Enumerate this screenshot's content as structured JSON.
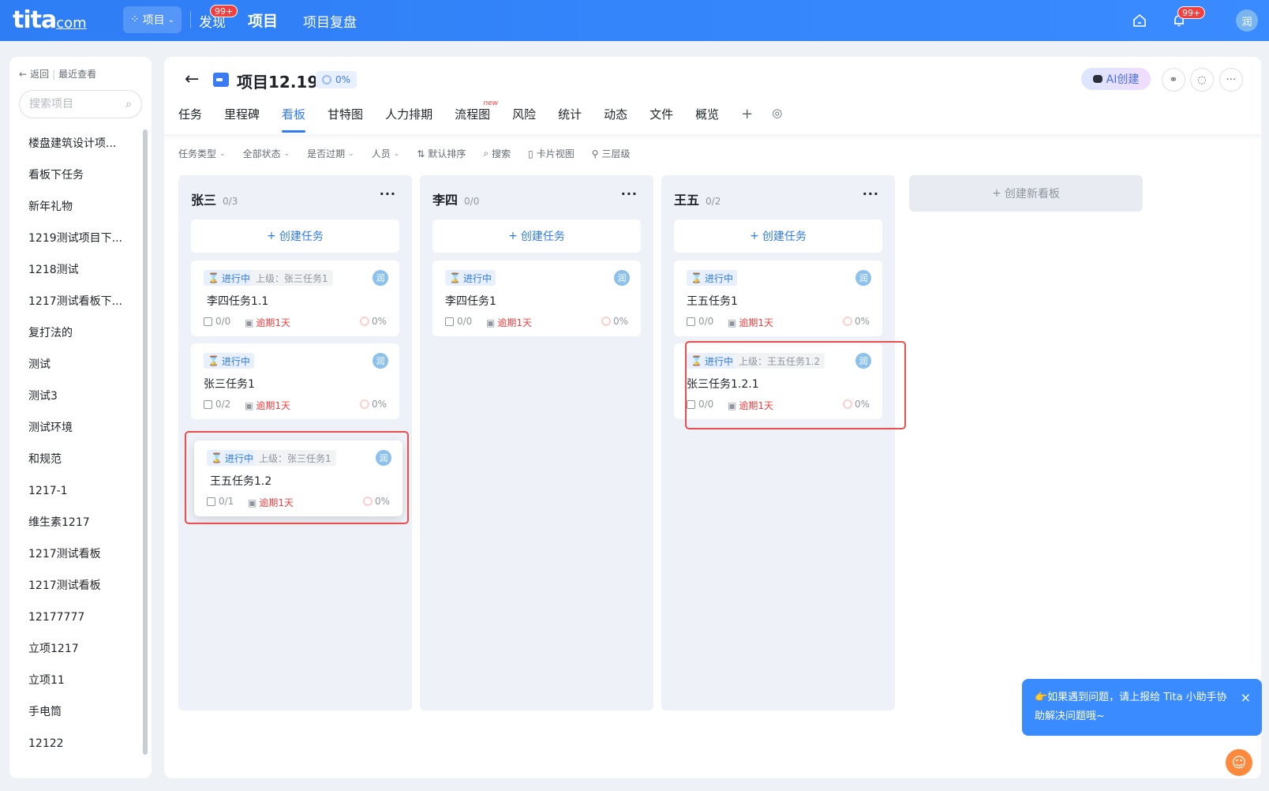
{
  "topbar": {
    "logo": "tita",
    "logo_suffix": "com",
    "project_switch": "项目",
    "nav": [
      {
        "label": "发现",
        "badge": "99+"
      },
      {
        "label": "项目"
      },
      {
        "label": "项目复盘"
      }
    ],
    "notification_badge": "99+",
    "avatar": "润"
  },
  "sidebar": {
    "back": "返回",
    "recent": "最近查看",
    "search_placeholder": "搜索项目",
    "items": [
      "楼盘建筑设计项...",
      "看板下任务",
      "新年礼物",
      "1219测试项目下...",
      "1218测试",
      "1217测试看板下...",
      "复打法的",
      "测试",
      "测试3",
      "测试环境",
      "和规范",
      "1217-1",
      "维生素1217",
      "1217测试看板",
      "1217测试看板",
      "12177777",
      "立项1217",
      "立项11",
      "手电筒",
      "12122"
    ]
  },
  "project": {
    "title": "项目12.19",
    "progress": "0%",
    "ai_button": "AI创建"
  },
  "tabs": [
    {
      "label": "任务"
    },
    {
      "label": "里程碑"
    },
    {
      "label": "看板",
      "active": true
    },
    {
      "label": "甘特图"
    },
    {
      "label": "人力排期"
    },
    {
      "label": "流程图",
      "tag": "new"
    },
    {
      "label": "风险"
    },
    {
      "label": "统计"
    },
    {
      "label": "动态"
    },
    {
      "label": "文件"
    },
    {
      "label": "概览"
    }
  ],
  "toolbar": {
    "task_type": "任务类型",
    "all_status": "全部状态",
    "overdue": "是否过期",
    "people": "人员",
    "sort": "默认排序",
    "search": "搜索",
    "card_view": "卡片视图",
    "levels": "三层级"
  },
  "columns": [
    {
      "name": "张三",
      "count": "0/3",
      "create": "创建任务",
      "cards": [
        {
          "status": "进行中",
          "parent": "上级：张三任务1",
          "owner": "润",
          "title": "李四任务1.1",
          "subtasks": "0/0",
          "due": "逾期1天",
          "progress": "0%"
        },
        {
          "status": "进行中",
          "parent": "",
          "owner": "润",
          "title": "张三任务1",
          "subtasks": "0/2",
          "due": "逾期1天",
          "progress": "0%"
        },
        {
          "status": "进行中",
          "parent": "上级：张三任务1",
          "owner": "润",
          "title": "王五任务1.2",
          "subtasks": "0/1",
          "due": "逾期1天",
          "progress": "0%"
        }
      ]
    },
    {
      "name": "李四",
      "count": "0/0",
      "create": "创建任务",
      "cards": [
        {
          "status": "进行中",
          "parent": "",
          "owner": "润",
          "title": "李四任务1",
          "subtasks": "0/0",
          "due": "逾期1天",
          "progress": "0%"
        }
      ]
    },
    {
      "name": "王五",
      "count": "0/2",
      "create": "创建任务",
      "cards": [
        {
          "status": "进行中",
          "parent": "",
          "owner": "润",
          "title": "王五任务1",
          "subtasks": "0/0",
          "due": "逾期1天",
          "progress": "0%"
        },
        {
          "status": "进行中",
          "parent": "上级：王五任务1.2",
          "owner": "润",
          "title": "张三任务1.2.1",
          "subtasks": "0/0",
          "due": "逾期1天",
          "progress": "0%"
        }
      ]
    }
  ],
  "new_board": "创建新看板",
  "help": {
    "text": "👉如果遇到问题，请上报给 Tita 小助手协助解决问题哦~"
  }
}
